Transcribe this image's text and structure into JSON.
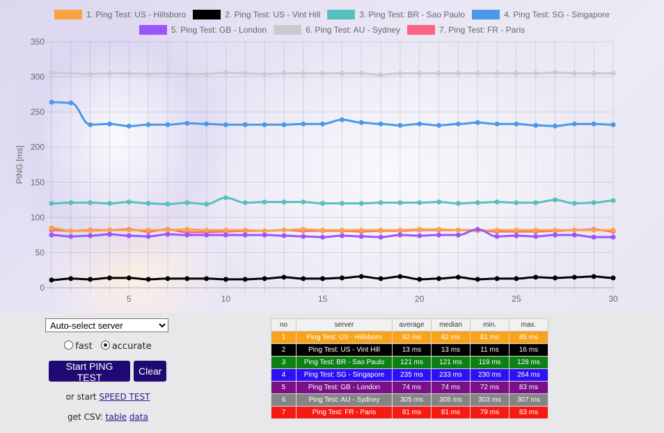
{
  "chart_data": {
    "type": "line",
    "title": "",
    "xlabel": "",
    "ylabel": "PING [ms]",
    "x": [
      1,
      2,
      3,
      4,
      5,
      6,
      7,
      8,
      9,
      10,
      11,
      12,
      13,
      14,
      15,
      16,
      17,
      18,
      19,
      20,
      21,
      22,
      23,
      24,
      25,
      26,
      27,
      28,
      29,
      30
    ],
    "xlim": [
      1,
      30
    ],
    "ylim": [
      0,
      350
    ],
    "x_ticks": [
      5,
      10,
      15,
      20,
      25,
      30
    ],
    "y_ticks": [
      0,
      50,
      100,
      150,
      200,
      250,
      300,
      350
    ],
    "grid": true,
    "legend_position": "top",
    "series": [
      {
        "name": "1. Ping Test: US - Hillsboro",
        "color": "#f9a444",
        "values": [
          85,
          81,
          81,
          82,
          82,
          82,
          82,
          83,
          82,
          82,
          82,
          81,
          82,
          83,
          82,
          82,
          82,
          82,
          82,
          83,
          83,
          82,
          81,
          82,
          82,
          82,
          82,
          82,
          82,
          82
        ]
      },
      {
        "name": "2. Ping Test: US - Vint Hill",
        "color": "#000000",
        "values": [
          11,
          13,
          12,
          14,
          14,
          12,
          13,
          13,
          13,
          12,
          12,
          13,
          15,
          13,
          13,
          14,
          16,
          13,
          16,
          12,
          13,
          15,
          12,
          13,
          13,
          15,
          14,
          15,
          16,
          14
        ]
      },
      {
        "name": "3. Ping Test: BR - Sao Paulo",
        "color": "#56c0bf",
        "values": [
          120,
          121,
          121,
          120,
          122,
          120,
          119,
          121,
          119,
          128,
          121,
          122,
          122,
          122,
          120,
          120,
          120,
          121,
          121,
          121,
          122,
          120,
          121,
          122,
          121,
          121,
          125,
          120,
          121,
          124
        ]
      },
      {
        "name": "4. Ping Test: SG - Singapore",
        "color": "#4a98e8",
        "values": [
          264,
          263,
          232,
          233,
          230,
          232,
          232,
          234,
          233,
          232,
          232,
          232,
          232,
          233,
          233,
          239,
          235,
          233,
          231,
          233,
          231,
          233,
          235,
          233,
          233,
          231,
          230,
          233,
          233,
          232
        ]
      },
      {
        "name": "5. Ping Test: GB - London",
        "color": "#9b55fb",
        "values": [
          75,
          73,
          74,
          76,
          74,
          73,
          76,
          75,
          75,
          75,
          75,
          75,
          74,
          73,
          72,
          74,
          73,
          72,
          75,
          74,
          75,
          75,
          83,
          73,
          74,
          73,
          75,
          75,
          72,
          72
        ]
      },
      {
        "name": "6. Ping Test: AU - Sydney",
        "color": "#c9cbcf",
        "values": [
          306,
          305,
          304,
          305,
          305,
          304,
          305,
          304,
          304,
          306,
          305,
          304,
          305,
          305,
          305,
          305,
          305,
          303,
          305,
          305,
          305,
          305,
          305,
          305,
          305,
          305,
          306,
          305,
          305,
          305
        ]
      },
      {
        "name": "7. Ping Test: FR - Paris",
        "color": "#fe6384",
        "values": [
          82,
          81,
          82,
          82,
          83,
          80,
          83,
          79,
          79,
          80,
          81,
          81,
          82,
          81,
          81,
          81,
          80,
          81,
          81,
          82,
          82,
          82,
          82,
          80,
          80,
          80,
          81,
          82,
          83,
          80
        ]
      }
    ]
  },
  "controls": {
    "server_select": "Auto-select server",
    "radio_fast": "fast",
    "radio_accurate": "accurate",
    "selected_mode": "accurate",
    "start_button": "Start PING TEST",
    "clear_button": "Clear",
    "or_start_prefix": "or start",
    "speed_test_link": "SPEED TEST",
    "csv_prefix": "get CSV:",
    "csv_table_link": "table",
    "csv_data_link": "data"
  },
  "table": {
    "headers": [
      "no",
      "server",
      "average",
      "median",
      "min.",
      "max."
    ],
    "rows": [
      {
        "no": "1",
        "server": "Ping Test: US - Hillsboro",
        "average": "82 ms",
        "median": "82 ms",
        "min": "81 ms",
        "max": "85 ms",
        "bg": "#f7a31b"
      },
      {
        "no": "2",
        "server": "Ping Test: US - Vint Hill",
        "average": "13 ms",
        "median": "13 ms",
        "min": "11 ms",
        "max": "16 ms",
        "bg": "#000000"
      },
      {
        "no": "3",
        "server": "Ping Test: BR - Sao Paulo",
        "average": "121 ms",
        "median": "121 ms",
        "min": "119 ms",
        "max": "128 ms",
        "bg": "#0c8012"
      },
      {
        "no": "4",
        "server": "Ping Test: SG - Singapore",
        "average": "235 ms",
        "median": "233 ms",
        "min": "230 ms",
        "max": "264 ms",
        "bg": "#2f10f5"
      },
      {
        "no": "5",
        "server": "Ping Test: GB - London",
        "average": "74 ms",
        "median": "74 ms",
        "min": "72 ms",
        "max": "83 ms",
        "bg": "#7a0f87"
      },
      {
        "no": "6",
        "server": "Ping Test: AU - Sydney",
        "average": "305 ms",
        "median": "305 ms",
        "min": "303 ms",
        "max": "307 ms",
        "bg": "#848484"
      },
      {
        "no": "7",
        "server": "Ping Test: FR - Paris",
        "average": "81 ms",
        "median": "81 ms",
        "min": "79 ms",
        "max": "83 ms",
        "bg": "#f71a12"
      }
    ]
  }
}
